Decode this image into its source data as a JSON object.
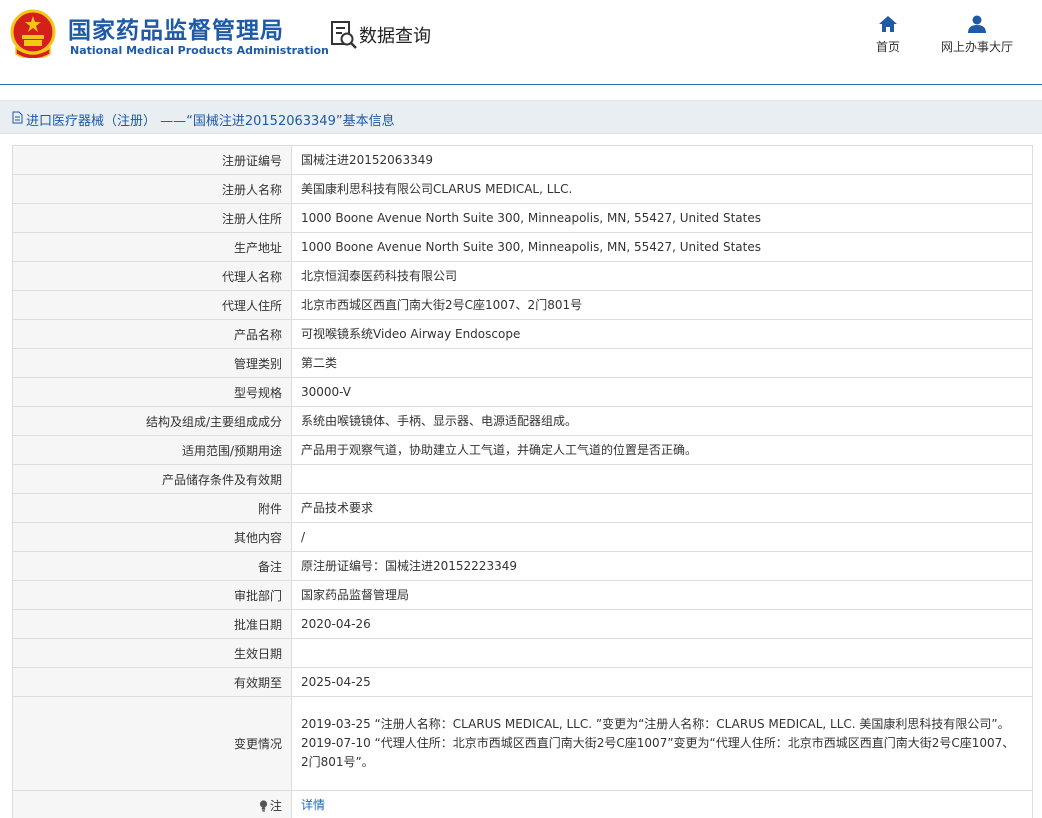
{
  "header": {
    "logo_cn": "国家药品监督管理局",
    "logo_en": "National Medical Products Administration",
    "section_label": "数据查询",
    "nav": [
      {
        "label": "首页",
        "icon": "home-icon"
      },
      {
        "label": "网上办事大厅",
        "icon": "user-icon"
      }
    ]
  },
  "page": {
    "title": "进口医疗器械（注册） ——“国械注进20152063349”基本信息"
  },
  "fields": [
    {
      "label": "注册证编号",
      "value": "国械注进20152063349"
    },
    {
      "label": "注册人名称",
      "value": "美国康利思科技有限公司CLARUS MEDICAL, LLC."
    },
    {
      "label": "注册人住所",
      "value": "1000 Boone Avenue North Suite 300, Minneapolis, MN, 55427, United States"
    },
    {
      "label": "生产地址",
      "value": "1000 Boone Avenue North Suite 300, Minneapolis, MN, 55427, United States"
    },
    {
      "label": "代理人名称",
      "value": "北京恒润泰医药科技有限公司"
    },
    {
      "label": "代理人住所",
      "value": "北京市西城区西直门南大街2号C座1007、2门801号"
    },
    {
      "label": "产品名称",
      "value": "可视喉镜系统Video Airway Endoscope"
    },
    {
      "label": "管理类别",
      "value": "第二类"
    },
    {
      "label": "型号规格",
      "value": "30000-V"
    },
    {
      "label": "结构及组成/主要组成成分",
      "value": "系统由喉镜镜体、手柄、显示器、电源适配器组成。"
    },
    {
      "label": "适用范围/预期用途",
      "value": "产品用于观察气道，协助建立人工气道，并确定人工气道的位置是否正确。"
    },
    {
      "label": "产品储存条件及有效期",
      "value": ""
    },
    {
      "label": "附件",
      "value": "产品技术要求"
    },
    {
      "label": "其他内容",
      "value": "/"
    },
    {
      "label": "备注",
      "value": "原注册证编号：国械注进20152223349"
    },
    {
      "label": "审批部门",
      "value": "国家药品监督管理局"
    },
    {
      "label": "批准日期",
      "value": "2020-04-26"
    },
    {
      "label": "生效日期",
      "value": ""
    },
    {
      "label": "有效期至",
      "value": "2025-04-25"
    }
  ],
  "changes": {
    "label": "变更情况",
    "lines": [
      "2019-03-25 “注册人名称：CLARUS MEDICAL, LLC. ”变更为“注册人名称：CLARUS MEDICAL, LLC. 美国康利思科技有限公司”。",
      "2019-07-10 “代理人住所：北京市西城区西直门南大街2号C座1007”变更为“代理人住所：北京市西城区西直门南大街2号C座1007、2门801号”。"
    ]
  },
  "note": {
    "label": "注",
    "icon": "lightbulb-icon",
    "link_text": "详情"
  },
  "colors": {
    "brand_blue": "#1e5aa8",
    "link_blue": "#1e6bb8",
    "emblem_red": "#d4201b",
    "emblem_gold": "#f5c518"
  }
}
